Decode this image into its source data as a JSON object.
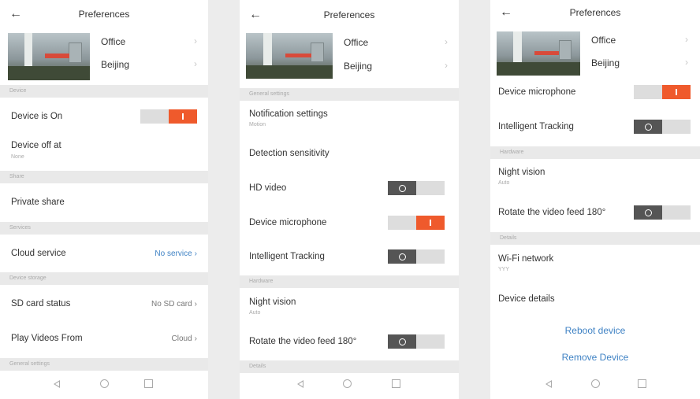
{
  "header": {
    "title": "Preferences"
  },
  "camera": {
    "location": "Office",
    "city": "Beijing"
  },
  "panel1": {
    "section_device": "Device",
    "device_on": {
      "label": "Device is On",
      "on": true
    },
    "device_off_at": {
      "label": "Device off at",
      "sub": "None"
    },
    "section_share": "Share",
    "private_share": "Private share",
    "section_services": "Services",
    "cloud_service": {
      "label": "Cloud service",
      "value": "No service"
    },
    "section_storage": "Device storage",
    "sd_card": {
      "label": "SD card status",
      "value": "No SD card"
    },
    "play_from": {
      "label": "Play Videos From",
      "value": "Cloud"
    },
    "section_general": "General settings"
  },
  "panel2": {
    "section_general": "General settings",
    "notification": {
      "label": "Notification settings",
      "sub": "Motion"
    },
    "detection": "Detection sensitivity",
    "hd_video": {
      "label": "HD video",
      "on": false
    },
    "microphone": {
      "label": "Device microphone",
      "on": true
    },
    "tracking": {
      "label": "Intelligent Tracking",
      "on": false
    },
    "section_hardware": "Hardware",
    "night_vision": {
      "label": "Night vision",
      "sub": "Auto"
    },
    "rotate": {
      "label": "Rotate the video feed 180°",
      "on": false
    },
    "section_details": "Details"
  },
  "panel3": {
    "microphone": {
      "label": "Device microphone",
      "on": true
    },
    "tracking": {
      "label": "Intelligent Tracking",
      "on": false
    },
    "section_hardware": "Hardware",
    "night_vision": {
      "label": "Night vision",
      "sub": "Auto"
    },
    "rotate": {
      "label": "Rotate the video feed 180°",
      "on": false
    },
    "section_details": "Details",
    "wifi": {
      "label": "Wi-Fi network",
      "sub": "YYY"
    },
    "device_details": "Device details",
    "reboot": "Reboot device",
    "remove": "Remove Device"
  },
  "icons": {
    "back": "arrow-left-icon",
    "chevron": "chevron-right-icon",
    "nav_back": "triangle-left-icon",
    "nav_home": "circle-icon",
    "nav_recent": "square-icon"
  },
  "colors": {
    "accent": "#ef5a2c",
    "toggle_off_knob": "#555555",
    "link": "#3f82c4",
    "section_bg": "#e9e9e9"
  }
}
